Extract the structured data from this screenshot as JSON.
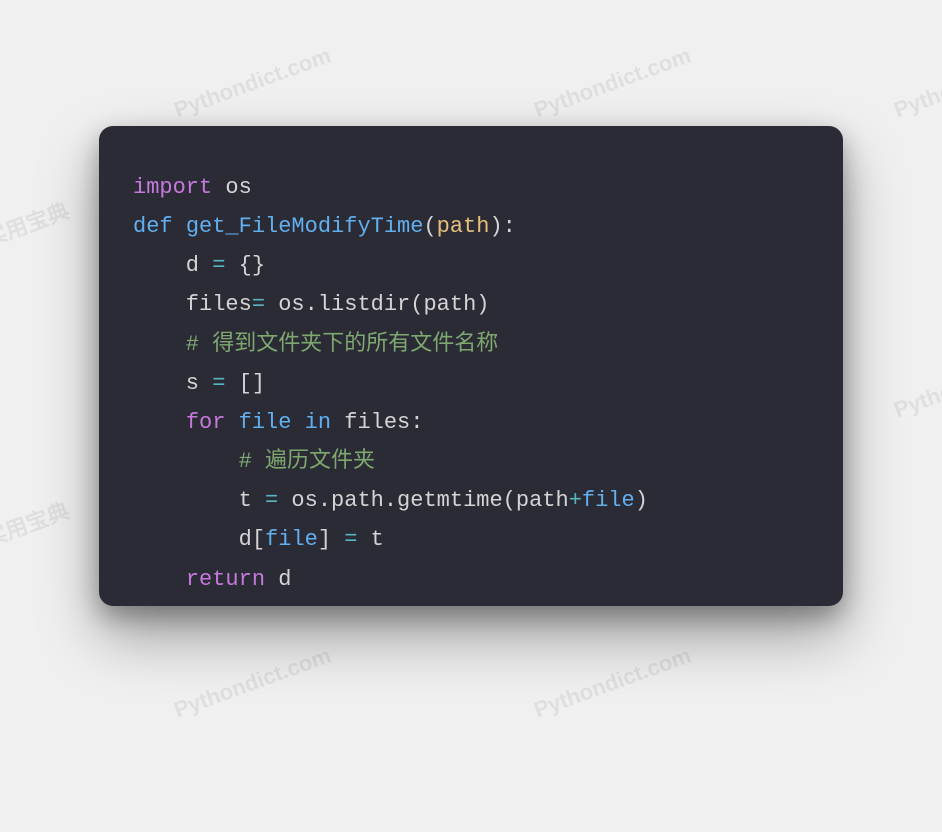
{
  "watermark": {
    "text_main": "Python实用宝典",
    "text_alt": "Pythondict.com"
  },
  "code": {
    "l1": {
      "kw": "import",
      "mod": "os"
    },
    "l2": {
      "kw": "def",
      "fn": "get_FileModifyTime",
      "lp": "(",
      "param": "path",
      "rp": "):"
    },
    "l3": {
      "text": "    d ",
      "op": "=",
      "rest": " {}"
    },
    "l4": {
      "text": "    files",
      "op": "=",
      "rest": " os.listdir(path)"
    },
    "l5": {
      "comment": "    # 得到文件夹下的所有文件名称"
    },
    "l6": {
      "text": "    s ",
      "op": "=",
      "rest": " []"
    },
    "l7": {
      "indent": "    ",
      "for": "for",
      "sp1": " ",
      "file": "file",
      "sp2": " ",
      "in": "in",
      "sp3": " ",
      "files": "files:"
    },
    "l8": {
      "comment": "        # 遍历文件夹"
    },
    "l9": {
      "indent": "        t ",
      "op": "=",
      "rest1": " os.path.getmtime(path",
      "plus": "+",
      "file": "file",
      "rest2": ")"
    },
    "l10": {
      "indent": "        d[",
      "file": "file",
      "rest": "] ",
      "op": "=",
      "t": " t"
    },
    "l11": {
      "indent": "    ",
      "return": "return",
      "d": " d"
    }
  }
}
